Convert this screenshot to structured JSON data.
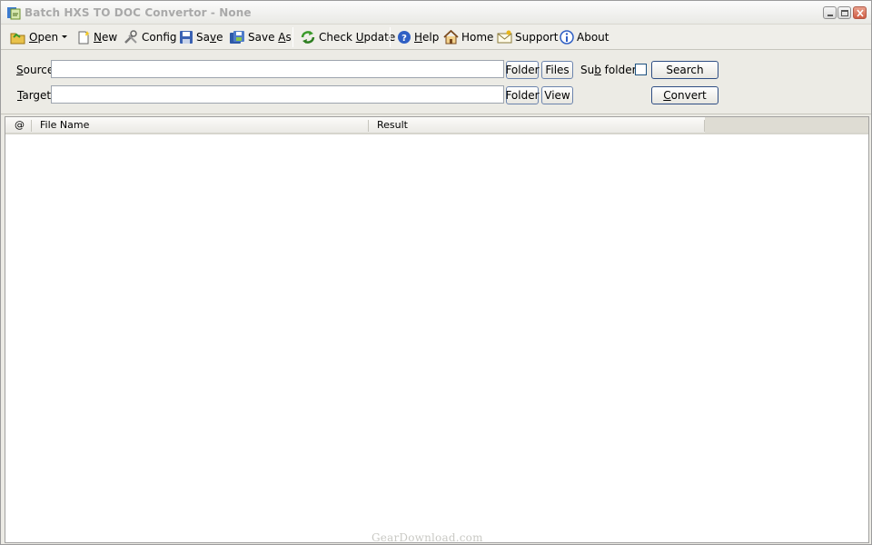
{
  "window": {
    "title": "Batch HXS TO DOC Convertor - None"
  },
  "toolbar": {
    "open_prefix": "",
    "open_key": "O",
    "open_rest": "pen",
    "new_key": "N",
    "new_rest": "ew",
    "config": "Config",
    "save_prefix": "Sa",
    "save_key": "v",
    "save_rest": "e",
    "saveas_prefix": "Save ",
    "saveas_key": "A",
    "saveas_rest": "s",
    "check_prefix": "Check ",
    "check_key": "U",
    "check_rest": "pdate",
    "help_key": "H",
    "help_rest": "elp",
    "home": "Home",
    "support": "Support",
    "about": "About"
  },
  "form": {
    "source_key": "S",
    "source_rest": "ource",
    "target_key": "T",
    "target_rest": "arget",
    "source_value": "",
    "target_value": "",
    "folder_label": "Folder",
    "files_label": "Files",
    "view_label": "View",
    "subfolders_prefix": "Su",
    "subfolders_key": "b",
    "subfolders_rest": " folders",
    "subfolders_checked": false,
    "search_label": "Search",
    "convert_key": "C",
    "convert_rest": "onvert"
  },
  "list": {
    "columns": [
      "@",
      "File Name",
      "Result"
    ],
    "rows": []
  },
  "watermark": "GearDownload.com",
  "colors": {
    "title_text": "#a9a9a9",
    "button_border": "#2f4e84",
    "window_bg": "#ecebe5"
  }
}
